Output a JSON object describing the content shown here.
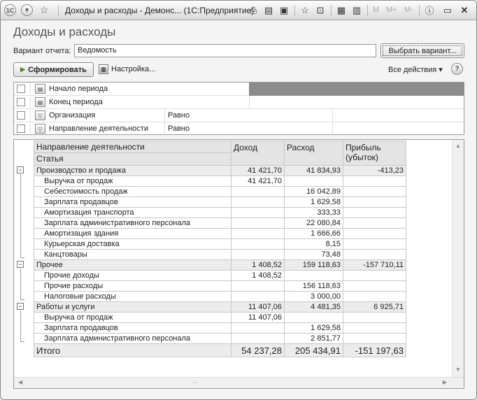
{
  "window": {
    "logo": "1С",
    "title": "Доходы и расходы - Демонс... (1С:Предприятие)",
    "m_buttons": [
      "M",
      "M+",
      "M-"
    ]
  },
  "page": {
    "heading": "Доходы и расходы",
    "variant_label": "Вариант отчета:",
    "variant_value": "Ведомость",
    "choose_variant": "Выбрать вариант...",
    "generate": "Сформировать",
    "settings": "Настройка...",
    "all_actions": "Все действия ▾",
    "help": "?"
  },
  "filters": [
    {
      "name": "Начало периода",
      "cond": ""
    },
    {
      "name": "Конец периода",
      "cond": ""
    },
    {
      "name": "Организация",
      "cond": "Равно"
    },
    {
      "name": "Направление деятельности",
      "cond": "Равно"
    }
  ],
  "report": {
    "header": {
      "c1a": "Направление деятельности",
      "c1b": "Статья",
      "c2": "Доход",
      "c3": "Расход",
      "c4a": "Прибыль",
      "c4b": "(убыток)"
    },
    "rows": [
      {
        "label": "Производство и продажа",
        "income": "41 421,70",
        "expense": "41 834,93",
        "profit": "-413,23",
        "group": true
      },
      {
        "label": "Выручка от продаж",
        "income": "41 421,70",
        "expense": "",
        "profit": ""
      },
      {
        "label": "Себестоимость продаж",
        "income": "",
        "expense": "16 042,89",
        "profit": ""
      },
      {
        "label": "Зарплата продавцов",
        "income": "",
        "expense": "1 629,58",
        "profit": ""
      },
      {
        "label": "Амортизация транспорта",
        "income": "",
        "expense": "333,33",
        "profit": ""
      },
      {
        "label": "Зарплата административного персонала",
        "income": "",
        "expense": "22 080,84",
        "profit": ""
      },
      {
        "label": "Амортизация здания",
        "income": "",
        "expense": "1 666,66",
        "profit": ""
      },
      {
        "label": "Курьерская доставка",
        "income": "",
        "expense": "8,15",
        "profit": ""
      },
      {
        "label": "Канцтовары",
        "income": "",
        "expense": "73,48",
        "profit": ""
      },
      {
        "label": "Прочее",
        "income": "1 408,52",
        "expense": "159 118,63",
        "profit": "-157 710,11",
        "group": true
      },
      {
        "label": "Прочие доходы",
        "income": "1 408,52",
        "expense": "",
        "profit": ""
      },
      {
        "label": "Прочие расходы",
        "income": "",
        "expense": "156 118,63",
        "profit": ""
      },
      {
        "label": "Налоговые расходы",
        "income": "",
        "expense": "3 000,00",
        "profit": ""
      },
      {
        "label": "Работы и услуги",
        "income": "11 407,06",
        "expense": "4 481,35",
        "profit": "6 925,71",
        "group": true
      },
      {
        "label": "Выручка от продаж",
        "income": "11 407,06",
        "expense": "",
        "profit": ""
      },
      {
        "label": "Зарплата продавцов",
        "income": "",
        "expense": "1 629,58",
        "profit": ""
      },
      {
        "label": "Зарплата административного персонала",
        "income": "",
        "expense": "2 851,77",
        "profit": ""
      }
    ],
    "total": {
      "label": "Итого",
      "income": "54 237,28",
      "expense": "205 434,91",
      "profit": "-151 197,63"
    }
  }
}
